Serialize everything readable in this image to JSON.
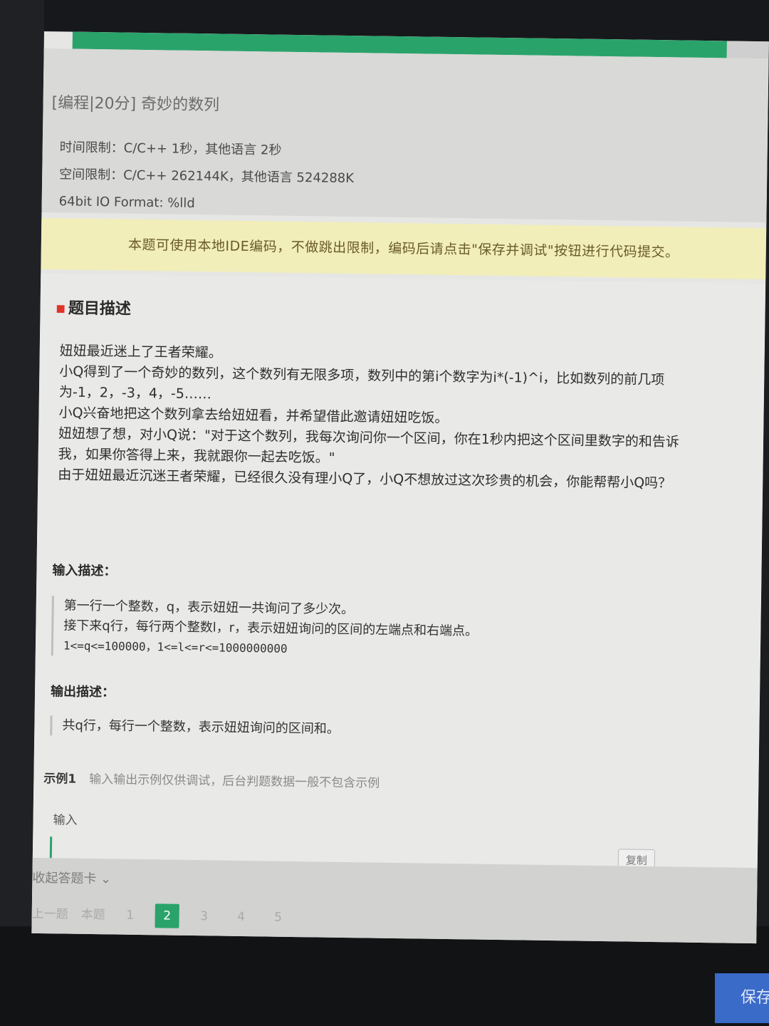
{
  "progress": {
    "fraction": 0.94
  },
  "problem": {
    "title": "[编程|20分] 奇妙的数列",
    "time_limit": "时间限制：C/C++ 1秒，其他语言 2秒",
    "space_limit": "空间限制：C/C++ 262144K，其他语言 524288K",
    "io_format": "64bit IO Format: %lld"
  },
  "notice": "本题可使用本地IDE编码，不做跳出限制，编码后请点击\"保存并调试\"按钮进行代码提交。",
  "description": {
    "heading": "题目描述",
    "paragraphs": [
      "妞妞最近迷上了王者荣耀。",
      "小Q得到了一个奇妙的数列，这个数列有无限多项，数列中的第i个数字为i*(-1)^i，比如数列的前几项为-1，2，-3，4，-5……",
      "小Q兴奋地把这个数列拿去给妞妞看，并希望借此邀请妞妞吃饭。",
      "妞妞想了想，对小Q说：\"对于这个数列，我每次询问你一个区间，你在1秒内把这个区间里数字的和告诉我，如果你答得上来，我就跟你一起去吃饭。\"",
      "由于妞妞最近沉迷王者荣耀，已经很久没有理小Q了，小Q不想放过这次珍贵的机会，你能帮帮小Q吗？"
    ]
  },
  "input_desc": {
    "label": "输入描述：",
    "line1": "第一行一个整数，q，表示妞妞一共询问了多少次。",
    "line2": "接下来q行，每行两个整数l，r，表示妞妞询问的区间的左端点和右端点。",
    "line3": "1<=q<=100000，1<=l<=r<=1000000000"
  },
  "output_desc": {
    "label": "输出描述：",
    "line1": "共q行，每行一个整数，表示妞妞询问的区间和。"
  },
  "example": {
    "label": "示例1",
    "note": "输入输出示例仅供调试，后台判题数据一般不包含示例",
    "input_label": "输入",
    "copy_label": "复制"
  },
  "footer": {
    "collapse_label": "收起答题卡 ⌄",
    "prev_labels": [
      "上一题",
      "本题"
    ],
    "pages": [
      "1",
      "2",
      "3",
      "4",
      "5"
    ],
    "active_page": "2"
  },
  "save_button": "保存",
  "colors": {
    "accent_green": "#2aa36b",
    "notice_bg": "#f1eeb9",
    "save_blue": "#3a6bc9"
  }
}
